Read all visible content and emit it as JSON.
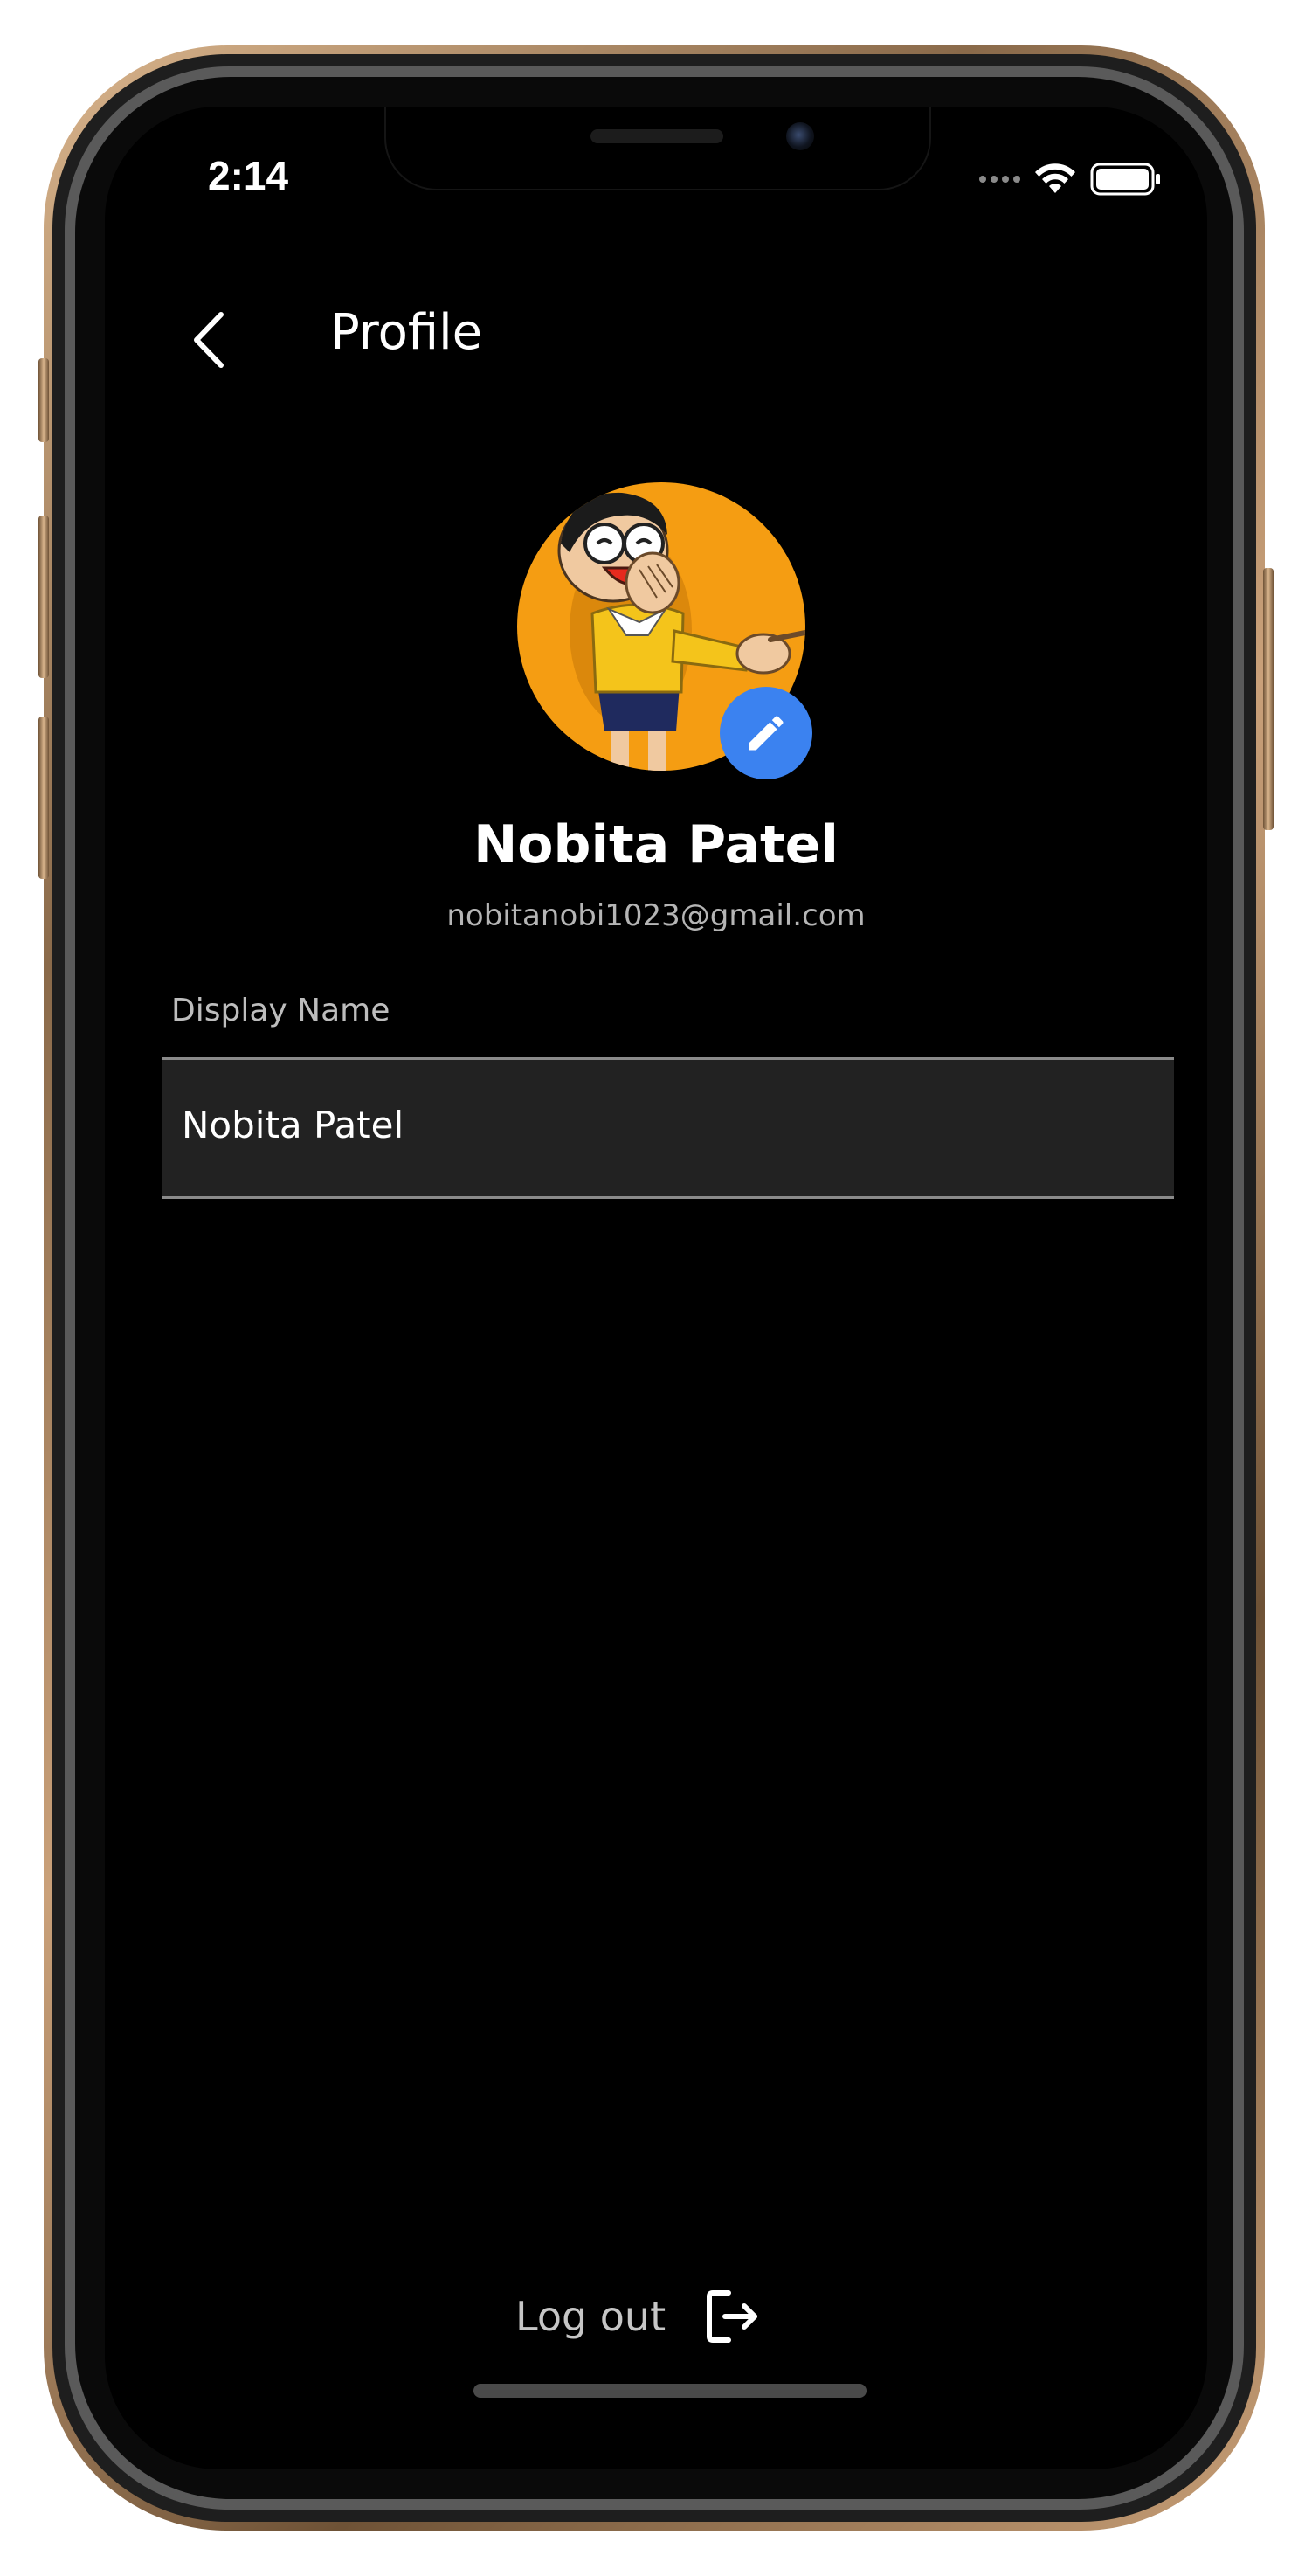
{
  "status_bar": {
    "time": "2:14"
  },
  "header": {
    "title": "Profile",
    "back_icon": "chevron-left-icon"
  },
  "profile": {
    "name": "Nobita Patel",
    "email": "nobitanobi1023@gmail.com",
    "avatar_icon": "cartoon-avatar",
    "edit_icon": "pencil-icon",
    "avatar_background": "#f59d12",
    "edit_button_color": "#3b82f0"
  },
  "display_name_field": {
    "label": "Display Name",
    "value": "Nobita Patel"
  },
  "logout": {
    "label": "Log out",
    "icon": "logout-icon"
  }
}
